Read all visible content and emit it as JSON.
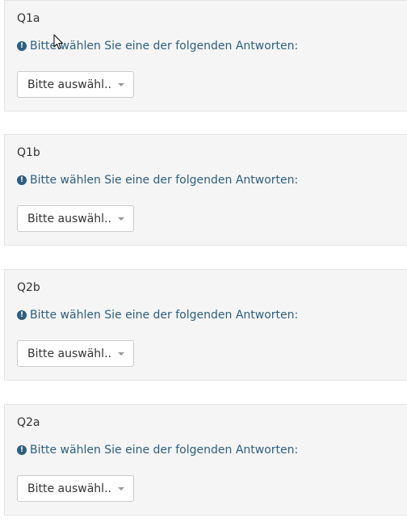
{
  "questions": [
    {
      "code": "Q1a",
      "tip": "Bitte wählen Sie eine der folgenden Antworten:",
      "select_value": "Bitte auswähl..."
    },
    {
      "code": "Q1b",
      "tip": "Bitte wählen Sie eine der folgenden Antworten:",
      "select_value": "Bitte auswähl..."
    },
    {
      "code": "Q2b",
      "tip": "Bitte wählen Sie eine der folgenden Antworten:",
      "select_value": "Bitte auswähl..."
    },
    {
      "code": "Q2a",
      "tip": "Bitte wählen Sie eine der folgenden Antworten:",
      "select_value": "Bitte auswähl..."
    }
  ],
  "icons": {
    "tip": "exclamation-circle-icon",
    "caret": "caret-down-icon",
    "cursor": "mouse-pointer-icon"
  },
  "colors": {
    "panel_background": "#f5f5f5",
    "panel_border": "#e3e3e3",
    "tip_text": "#2e5e7e",
    "select_border": "#cccccc"
  }
}
